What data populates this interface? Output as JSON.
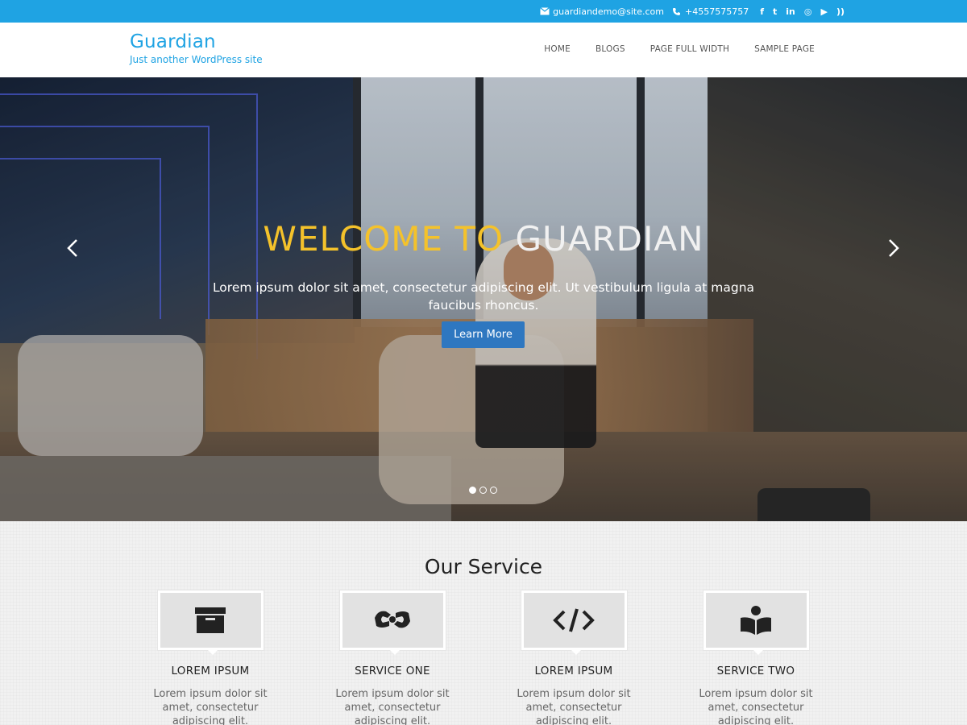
{
  "topbar": {
    "email": "guardiandemo@site.com",
    "phone": "+4557575757",
    "social_icons": [
      "facebook-icon",
      "twitter-icon",
      "linkedin-icon",
      "instagram-icon",
      "youtube-icon",
      "rss-icon"
    ],
    "social_glyphs": [
      "f",
      "t",
      "in",
      "◎",
      "▶",
      "))"
    ],
    "background": "#1fa3e3"
  },
  "header": {
    "site_title": "Guardian",
    "site_description": "Just another WordPress site",
    "brand_color": "#1fa3e3",
    "nav": [
      "HOME",
      "BLOGS",
      "PAGE FULL WIDTH",
      "SAMPLE PAGE"
    ]
  },
  "hero": {
    "title_highlight": "WELCOME TO",
    "title_rest": " GUARDIAN",
    "title_highlight_color": "#f4c22b",
    "text": "Lorem ipsum dolor sit amet, consectetur adipiscing elit. Ut vestibulum ligula at magna faucibus rhoncus.",
    "button_label": "Learn More",
    "button_color": "#2e77c0",
    "slide_count": 3,
    "active_slide": 1
  },
  "services": {
    "heading": "Our Service",
    "items": [
      {
        "icon": "archive-icon",
        "title": "LOREM IPSUM",
        "text": "Lorem ipsum dolor sit amet, consectetur adipiscing elit."
      },
      {
        "icon": "sign-language-icon",
        "title": "SERVICE ONE",
        "text": "Lorem ipsum dolor sit amet, consectetur adipiscing elit."
      },
      {
        "icon": "code-icon",
        "title": "LOREM IPSUM",
        "text": "Lorem ipsum dolor sit amet, consectetur adipiscing elit."
      },
      {
        "icon": "reader-icon",
        "title": "SERVICE TWO",
        "text": "Lorem ipsum dolor sit amet, consectetur adipiscing elit."
      }
    ]
  }
}
